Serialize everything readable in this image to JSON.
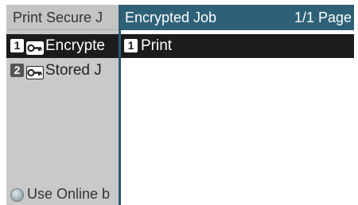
{
  "background_menu": {
    "title": "Print Secure J",
    "items": [
      {
        "number": "1",
        "icon": "key-icon",
        "label": "Encrypte"
      },
      {
        "number": "2",
        "icon": "key-icon",
        "label": "Stored J"
      }
    ],
    "footer_label": "Use Online b"
  },
  "overlay": {
    "title": "Encrypted Job",
    "page_indicator": "1/1 Page",
    "items": [
      {
        "number": "1",
        "label": "Print"
      }
    ]
  },
  "colors": {
    "overlay_header": "#2e6178",
    "selected_row": "#1c1c1c",
    "background_panel": "#c9c9c9"
  }
}
